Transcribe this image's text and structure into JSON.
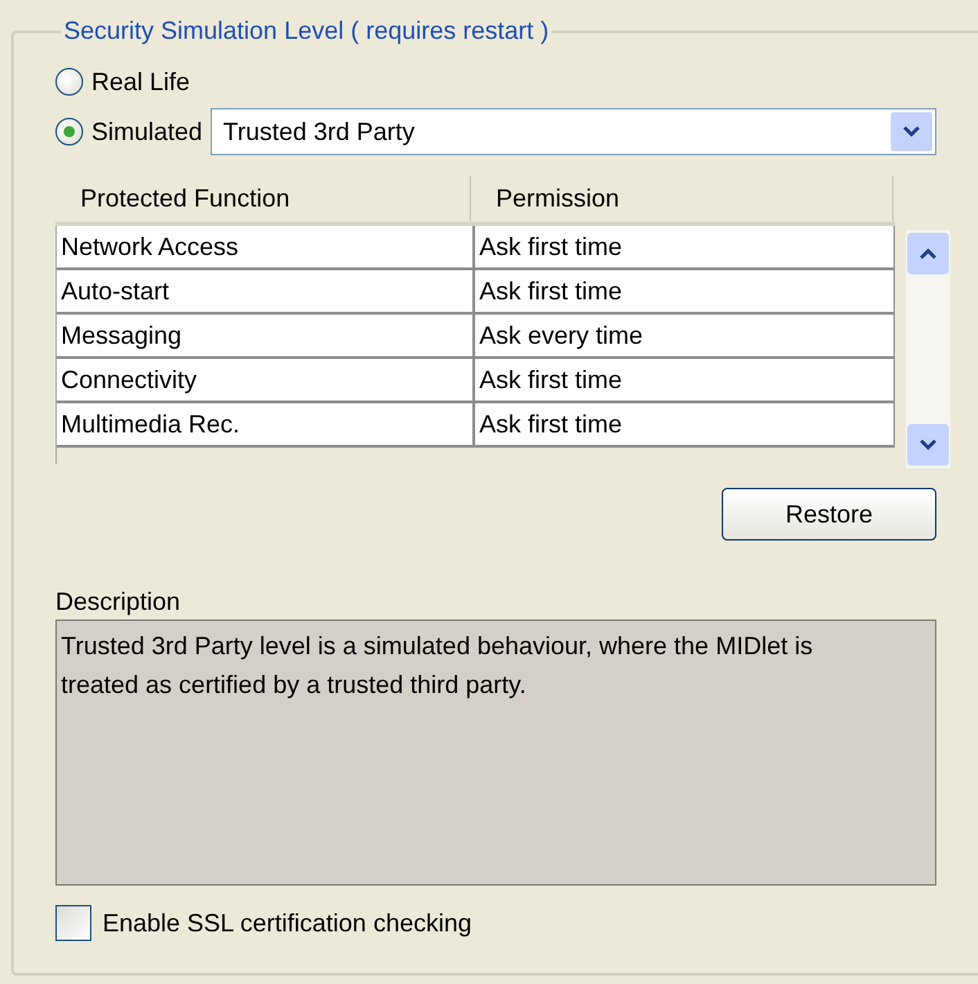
{
  "group": {
    "title": "Security Simulation Level ( requires restart )"
  },
  "modes": [
    {
      "label": "Real Life",
      "selected": false
    },
    {
      "label": "Simulated",
      "selected": true
    }
  ],
  "level_select": {
    "value": "Trusted 3rd Party"
  },
  "table": {
    "columns": [
      "Protected Function",
      "Permission"
    ],
    "rows": [
      {
        "function": "Network Access",
        "permission": "Ask first time"
      },
      {
        "function": "Auto-start",
        "permission": "Ask first time"
      },
      {
        "function": "Messaging",
        "permission": "Ask every time"
      },
      {
        "function": "Connectivity",
        "permission": "Ask first time"
      },
      {
        "function": "Multimedia Rec.",
        "permission": "Ask first time"
      }
    ]
  },
  "restore_button": "Restore",
  "description": {
    "label": "Description",
    "text": "Trusted 3rd Party level is a simulated behaviour, where the MIDlet is treated as certified by a trusted third party."
  },
  "ssl_checkbox": {
    "label": "Enable SSL certification checking",
    "checked": false
  }
}
